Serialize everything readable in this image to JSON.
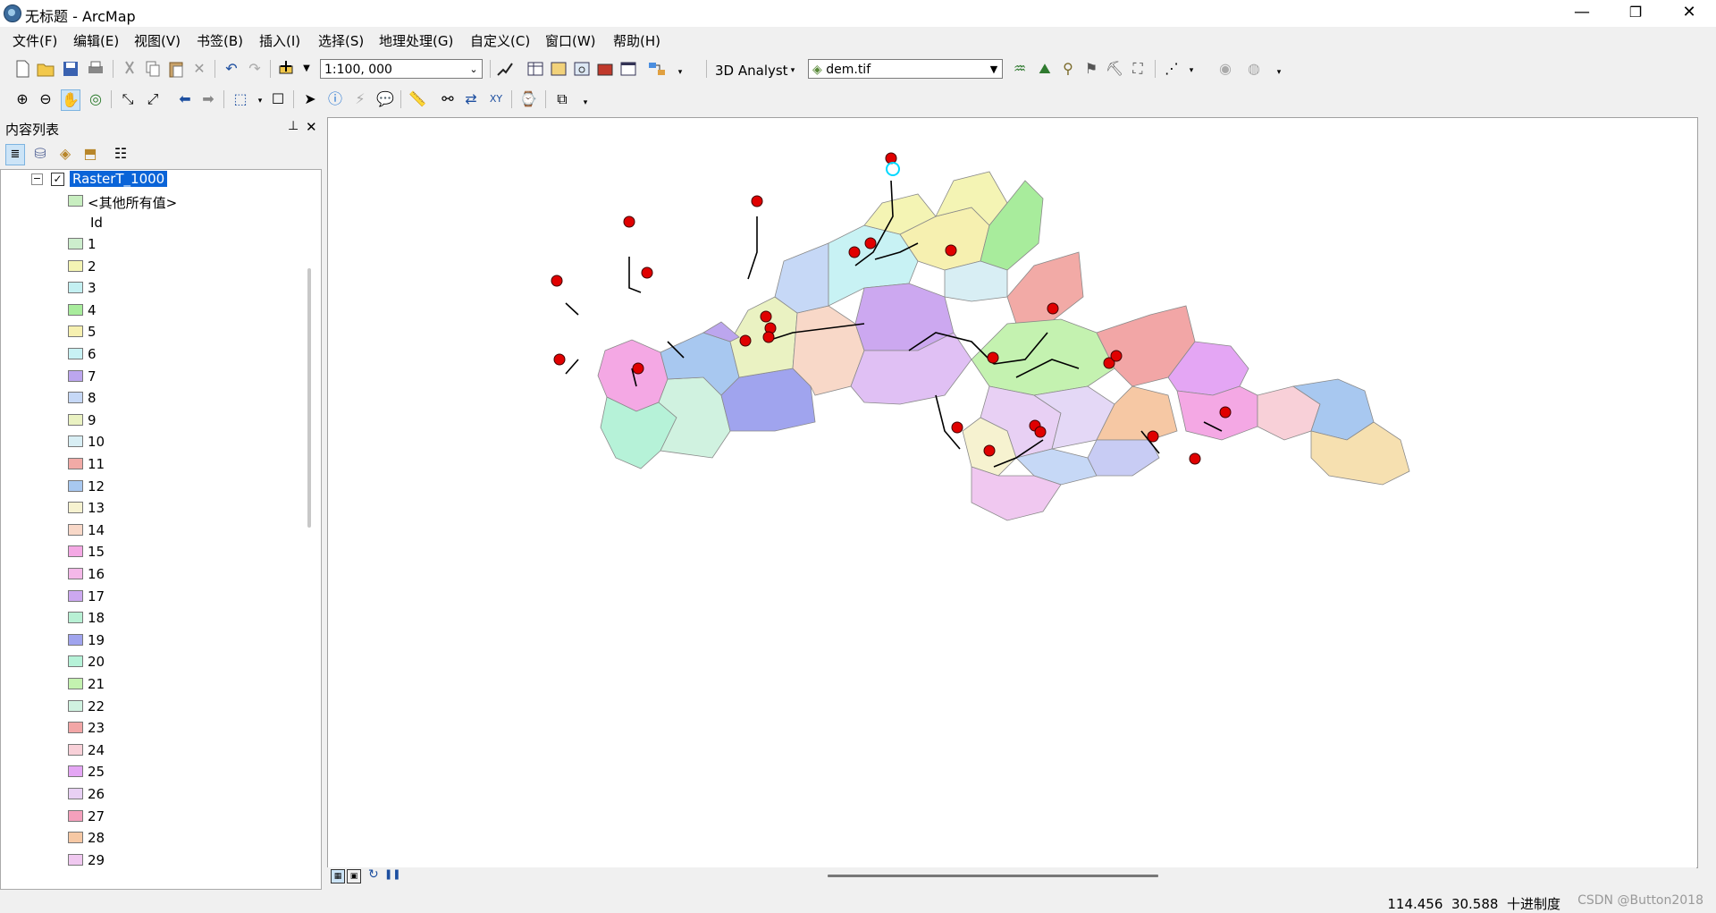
{
  "window": {
    "title": "无标题 - ArcMap",
    "minimize": "—",
    "restore": "❐",
    "close": "✕"
  },
  "menu": [
    "文件(F)",
    "编辑(E)",
    "视图(V)",
    "书签(B)",
    "插入(I)",
    "选择(S)",
    "地理处理(G)",
    "自定义(C)",
    "窗口(W)",
    "帮助(H)"
  ],
  "toolbar1": {
    "scale": "1:100, 000",
    "analyst_label": "3D Analyst",
    "layer": "dem.tif"
  },
  "toc": {
    "title": "内容列表",
    "pin": "ᚂ",
    "close": "✕",
    "layer_name": "RasterT_1000",
    "other_values": "<其他所有值>",
    "field_heading": "Id",
    "other_color": "#c8eec0",
    "classes": [
      {
        "label": "1",
        "color": "#cdeecd"
      },
      {
        "label": "2",
        "color": "#f4f4b4"
      },
      {
        "label": "3",
        "color": "#c4f0f2"
      },
      {
        "label": "4",
        "color": "#a8ec9c"
      },
      {
        "label": "5",
        "color": "#f6f0b0"
      },
      {
        "label": "6",
        "color": "#c8f2f4"
      },
      {
        "label": "7",
        "color": "#bca6ee"
      },
      {
        "label": "8",
        "color": "#c6d8f6"
      },
      {
        "label": "9",
        "color": "#eaf2c2"
      },
      {
        "label": "10",
        "color": "#d8eef4"
      },
      {
        "label": "11",
        "color": "#f2aaa6"
      },
      {
        "label": "12",
        "color": "#a8c8f0"
      },
      {
        "label": "13",
        "color": "#f6f2d0"
      },
      {
        "label": "14",
        "color": "#f8d8c8"
      },
      {
        "label": "15",
        "color": "#f4a8e4"
      },
      {
        "label": "16",
        "color": "#f4b8e8"
      },
      {
        "label": "17",
        "color": "#cca8f0"
      },
      {
        "label": "18",
        "color": "#b8f0d4"
      },
      {
        "label": "19",
        "color": "#a0a4ee"
      },
      {
        "label": "20",
        "color": "#b6f2d8"
      },
      {
        "label": "21",
        "color": "#c4f2b0"
      },
      {
        "label": "22",
        "color": "#d0f2e0"
      },
      {
        "label": "23",
        "color": "#f2a6a6"
      },
      {
        "label": "24",
        "color": "#f8d0d8"
      },
      {
        "label": "25",
        "color": "#e4a6f4"
      },
      {
        "label": "26",
        "color": "#e8d0f4"
      },
      {
        "label": "27",
        "color": "#f4a0bc"
      },
      {
        "label": "28",
        "color": "#f6c8a4"
      },
      {
        "label": "29",
        "color": "#f0c8f0"
      }
    ]
  },
  "status": {
    "x": "114.456",
    "y": "30.588",
    "units": "十进制度",
    "watermark": "CSDN @Button2018"
  }
}
